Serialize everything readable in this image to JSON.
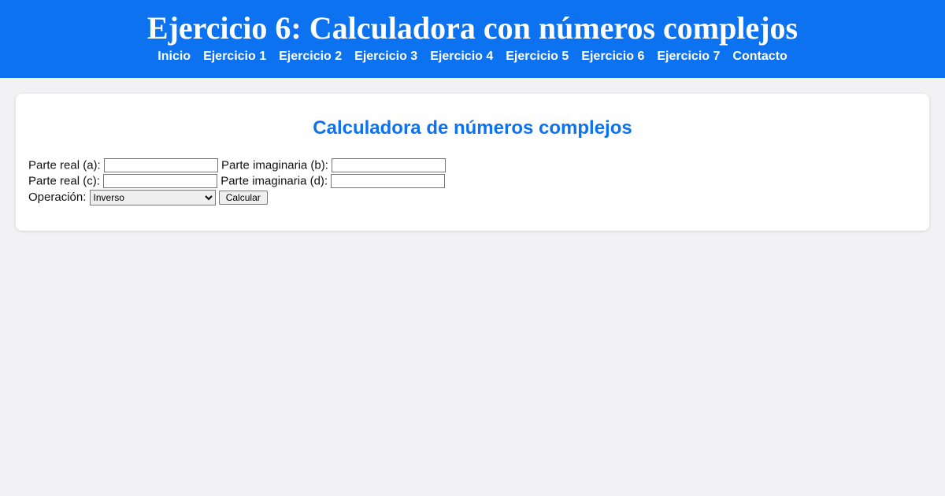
{
  "header": {
    "title": "Ejercicio 6: Calculadora con números complejos"
  },
  "nav": {
    "inicio": "Inicio",
    "ej1": "Ejercicio 1",
    "ej2": "Ejercicio 2",
    "ej3": "Ejercicio 3",
    "ej4": "Ejercicio 4",
    "ej5": "Ejercicio 5",
    "ej6": "Ejercicio 6",
    "ej7": "Ejercicio 7",
    "contacto": "Contacto"
  },
  "card": {
    "title": "Calculadora de números complejos"
  },
  "form": {
    "label_real_a": "Parte real (a):",
    "label_imag_b": "Parte imaginaria (b):",
    "label_real_c": "Parte real (c):",
    "label_imag_d": "Parte imaginaria (d):",
    "label_operacion": "Operación:",
    "select_value": "Inverso",
    "button_calcular": "Calcular",
    "input_a": "",
    "input_b": "",
    "input_c": "",
    "input_d": ""
  }
}
